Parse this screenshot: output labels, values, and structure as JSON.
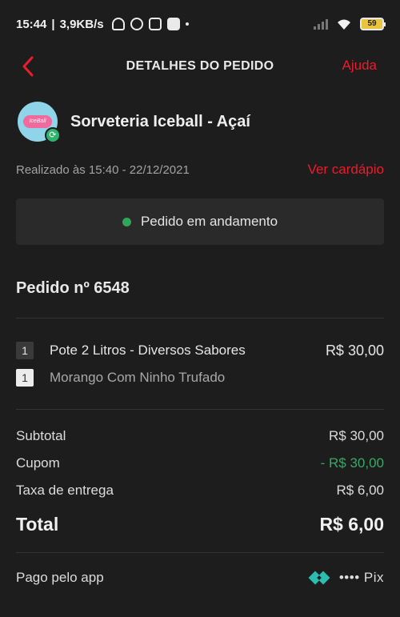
{
  "statusbar": {
    "time": "15:44",
    "speed": "3,9KB/s",
    "battery": "59",
    "icons": [
      "mute-icon",
      "whatsapp-icon",
      "instagram-icon",
      "app-icon",
      "dot-icon"
    ]
  },
  "header": {
    "back_icon": "chevron-left-icon",
    "title": "DETALHES DO PEDIDO",
    "help_label": "Ajuda"
  },
  "store": {
    "name": "Sorveteria Iceball - Açaí",
    "logo_text": "IceBall",
    "logo_badge_icon": "refresh-icon"
  },
  "meta": {
    "date": "Realizado às 15:40 - 22/12/2021",
    "menu_link": "Ver cardápio"
  },
  "status": {
    "text": "Pedido em andamento",
    "color": "#2fa75a"
  },
  "order": {
    "number_label": "Pedido nº 6548",
    "items": [
      {
        "qty": "1",
        "name": "Pote 2 Litros - Diversos Sabores",
        "price": "R$ 30,00"
      },
      {
        "qty": "1",
        "name": "Morango Com Ninho Trufado",
        "price": ""
      }
    ]
  },
  "summary": {
    "subtotal_label": "Subtotal",
    "subtotal_value": "R$ 30,00",
    "coupon_label": "Cupom",
    "coupon_value": "- R$ 30,00",
    "delivery_label": "Taxa de entrega",
    "delivery_value": "R$ 6,00",
    "total_label": "Total",
    "total_value": "R$ 6,00"
  },
  "payment": {
    "label": "Pago pelo app",
    "method": "•••• Pix",
    "icon": "pix-icon"
  },
  "colors": {
    "accent": "#ea1d2c",
    "background": "#1d1d1d",
    "success": "#38a866"
  }
}
